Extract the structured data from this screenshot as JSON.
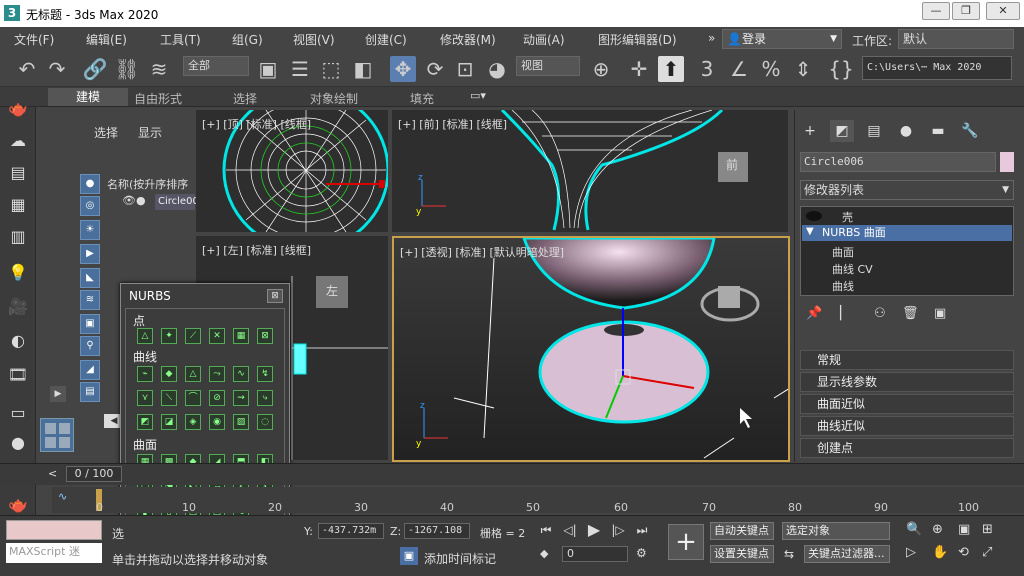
{
  "titlebar": {
    "title": "无标题 - 3ds Max 2020",
    "minimize": "—",
    "restore": "❐",
    "close": "✕"
  },
  "menu": [
    "文件(F)",
    "编辑(E)",
    "工具(T)",
    "组(G)",
    "视图(V)",
    "创建(C)",
    "修改器(M)",
    "动画(A)",
    "图形编辑器(D)"
  ],
  "login": "登录",
  "workspace": {
    "label": "工作区:",
    "value": "默认"
  },
  "toolbar": {
    "filter": "全部",
    "view_ref": "视图",
    "path": "C:\\Users\\⋯ Max 2020"
  },
  "ribbon": {
    "tabs": [
      "建模",
      "自由形式",
      "选择",
      "对象绘制",
      "填充"
    ]
  },
  "scene": {
    "tabs": [
      "选择",
      "显示"
    ],
    "sort": "名称(按升序排序",
    "object": "Circle00"
  },
  "viewports": {
    "top": "[+] [顶] [标准] [线框]",
    "front": "[+] [前] [标准] [线框]",
    "left": "[+] [左] [标准] [线框]",
    "persp": "[+] [透视] [标准] [默认明暗处理]",
    "front_cube": "前",
    "left_cube": "左"
  },
  "nurbs": {
    "title": "NURBS",
    "close": "⊠",
    "sections": [
      "点",
      "曲线",
      "曲面"
    ]
  },
  "command": {
    "object_name": "Circle006",
    "modifier_list": "修改器列表",
    "stack": [
      "壳",
      "NURBS 曲面",
      "曲面",
      "曲线 CV",
      "曲线"
    ],
    "rollouts": [
      "常规",
      "显示线参数",
      "曲面近似",
      "曲线近似",
      "创建点"
    ]
  },
  "timeline": {
    "frame": "0 / 100",
    "ticks": [
      "0",
      "10",
      "20",
      "30",
      "40",
      "50",
      "60",
      "70",
      "80",
      "90",
      "100"
    ]
  },
  "status": {
    "maxscript": "MAXScript 迷",
    "text": "单击并拖动以选择并移动对象",
    "sel": "选",
    "y_label": "Y:",
    "y_value": "-437.732m",
    "z_label": "Z:",
    "z_value": "-1267.108",
    "grid": "栅格 = 2",
    "addtime": "添加时间标记",
    "frame": "0",
    "autokey": "自动关键点",
    "setkey": "设置关键点",
    "selobj": "选定对象",
    "keyfilter": "关键点过滤器..."
  },
  "colors": {
    "accent": "#4a6fa5",
    "selection": "#00e5e5",
    "active_border": "#c8a14a"
  }
}
